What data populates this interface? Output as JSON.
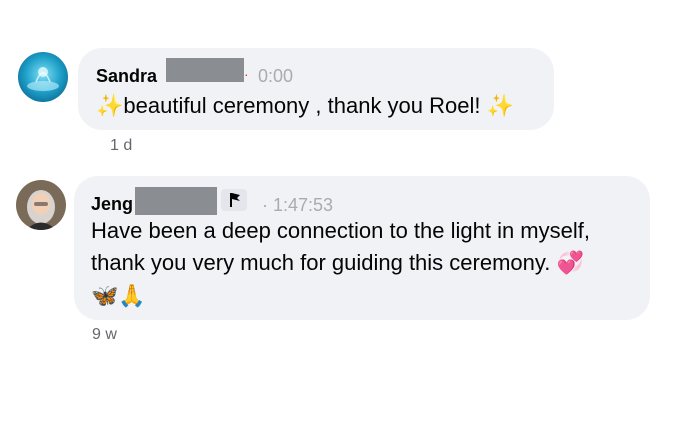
{
  "comments": [
    {
      "author": "Sandra",
      "time": "0:00",
      "text_prefix_icon": "sparkles-icon",
      "text": "beautiful ceremony , thank you Roel!",
      "text_suffix_icon": "sparkles-icon",
      "age": "1 d"
    },
    {
      "author": "Jeng",
      "time": "· 1:47:53",
      "text_line1": "Have been a deep connection to the light in myself,",
      "text_line2": "thank you very much for guiding this ceremony.",
      "line2_icon": "two-hearts-icon",
      "emoji_row": [
        "butterfly-icon",
        "folded-hands-icon"
      ],
      "age": "9 w"
    }
  ],
  "colors": {
    "bubble": "#f0f2f5",
    "timestamp": "#a8abaf",
    "meta": "#65676b",
    "redaction": "#8a8d91"
  }
}
